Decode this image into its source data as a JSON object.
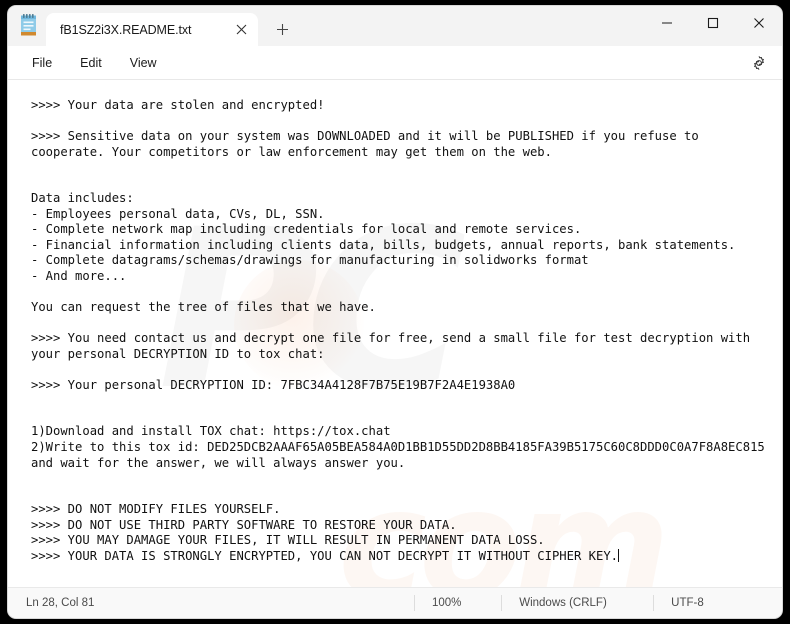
{
  "window": {
    "app_icon": "notepad-icon",
    "minimize_label": "—",
    "maximize_label": "□",
    "close_label": "✕"
  },
  "tab": {
    "title": "fB1SZ2i3X.README.txt",
    "close_icon": "close-icon",
    "new_tab_icon": "plus-icon"
  },
  "menubar": {
    "items": [
      {
        "label": "File"
      },
      {
        "label": "Edit"
      },
      {
        "label": "View"
      }
    ],
    "settings_icon": "gear-icon"
  },
  "document": {
    "lines": [
      ">>>> Your data are stolen and encrypted!",
      "",
      ">>>> Sensitive data on your system was DOWNLOADED and it will be PUBLISHED if you refuse to cooperate. Your competitors or law enforcement may get them on the web.",
      "",
      "",
      "Data includes:",
      "- Employees personal data, CVs, DL, SSN.",
      "- Complete network map including credentials for local and remote services.",
      "- Financial information including clients data, bills, budgets, annual reports, bank statements.",
      "- Complete datagrams/schemas/drawings for manufacturing in solidworks format",
      "- And more...",
      "",
      "You can request the tree of files that we have.",
      "",
      ">>>> You need contact us and decrypt one file for free, send a small file for test decryption with your personal DECRYPTION ID to tox chat:",
      "",
      ">>>> Your personal DECRYPTION ID: 7FBC34A4128F7B75E19B7F2A4E1938A0",
      "",
      "",
      "1)Download and install TOX chat: https://tox.chat",
      "2)Write to this tox id: DED25DCB2AAAF65A05BEA584A0D1BB1D55DD2D8BB4185FA39B5175C60C8DDD0C0A7F8A8EC815 and wait for the answer, we will always answer you.",
      "",
      "",
      ">>>> DO NOT MODIFY FILES YOURSELF.",
      ">>>> DO NOT USE THIRD PARTY SOFTWARE TO RESTORE YOUR DATA.",
      ">>>> YOU MAY DAMAGE YOUR FILES, IT WILL RESULT IN PERMANENT DATA LOSS.",
      ">>>> YOUR DATA IS STRONGLY ENCRYPTED, YOU CAN NOT DECRYPT IT WITHOUT CIPHER KEY."
    ],
    "decryption_id": "7FBC34A4128F7B75E19B7F2A4E1938A0",
    "tox_id": "DED25DCB2AAAF65A05BEA584A0D1BB1D55DD2D8BB4185FA39B5175C60C8DDD0C0A7F8A8EC815",
    "tox_url": "https://tox.chat"
  },
  "watermark": {
    "mark_primary": "PC",
    "mark_secondary": "com"
  },
  "statusbar": {
    "cursor": "Ln 28, Col 81",
    "zoom": "100%",
    "line_endings": "Windows (CRLF)",
    "encoding": "UTF-8"
  }
}
